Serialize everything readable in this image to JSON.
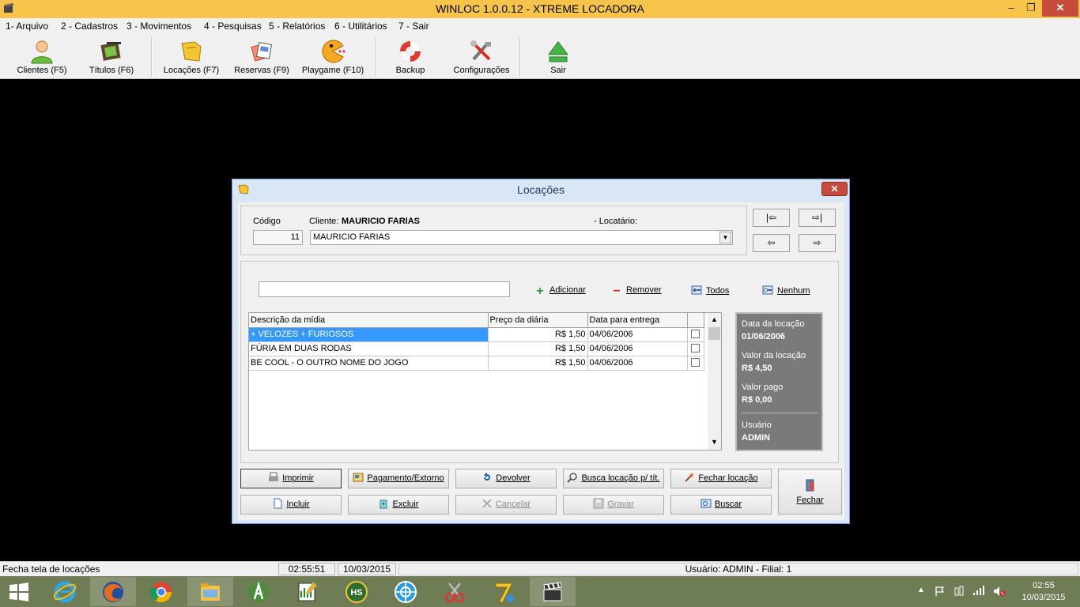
{
  "window": {
    "title": "WINLOC 1.0.0.12 - XTREME LOCADORA",
    "minimize": "–",
    "maximize": "❐",
    "close": "✕"
  },
  "menu": [
    {
      "label": "1- Arquivo"
    },
    {
      "label": "2 - Cadastros"
    },
    {
      "label": "3 - Movimentos"
    },
    {
      "label": "4 - Pesquisas"
    },
    {
      "label": "5 - Relatórios"
    },
    {
      "label": "6 - Utilitários"
    },
    {
      "label": "7 - Sair"
    }
  ],
  "toolbar": [
    {
      "label": "Clientes (F5)",
      "icon": "person-icon"
    },
    {
      "label": "Títulos (F6)",
      "icon": "film-icon"
    },
    {
      "label": "Locações (F7)",
      "icon": "rental-icon"
    },
    {
      "label": "Reservas (F9)",
      "icon": "reservation-icon"
    },
    {
      "label": "Playgame (F10)",
      "icon": "pacman-icon"
    },
    {
      "label": "Backup",
      "icon": "lifebuoy-icon"
    },
    {
      "label": "Configurações",
      "icon": "tools-icon"
    },
    {
      "label": "Sair",
      "icon": "exit-arrow-icon"
    }
  ],
  "dialog": {
    "title": "Locações",
    "close": "✕",
    "codigo_label": "Código",
    "codigo_value": "11",
    "cliente_label": "Cliente:",
    "cliente_name": "MAURICIO FARIAS",
    "locatario_label": "- Locatário:",
    "locatario_value": "MAURICIO FARIAS",
    "nav": {
      "first": "|⇦",
      "last": "⇨|",
      "prev": "⇦",
      "next": "⇨"
    },
    "search_value": "",
    "adicionar": "Adicionar",
    "remover": "Remover",
    "todos": "Todos",
    "nenhum": "Nenhum",
    "columns": [
      "Descrição da mídia",
      "Preço da diária",
      "Data para entrega",
      ""
    ],
    "rows": [
      {
        "desc": "+ VELOZES + FURIOSOS",
        "preco": "R$ 1,50",
        "data": "04/06/2006"
      },
      {
        "desc": "FÚRIA EM DUAS RODAS",
        "preco": "R$ 1,50",
        "data": "04/06/2006"
      },
      {
        "desc": "BE COOL - O OUTRO NOME DO JOGO",
        "preco": "R$ 1,50",
        "data": "04/06/2006"
      }
    ],
    "info": {
      "data_label": "Data da locação",
      "data_value": "01/06/2006",
      "valor_label": "Valor da locação",
      "valor_value": "R$ 4,50",
      "pago_label": "Valor pago",
      "pago_value": "R$ 0,00",
      "usuario_label": "Usuário",
      "usuario_value": "ADMIN"
    },
    "buttons": {
      "imprimir": "Imprimir",
      "pagamento": "Pagamento/Extorno",
      "devolver": "Devolver",
      "busca": "Busca locação p/ tít.",
      "fechar_loc": "Fechar locação",
      "fechar": "Fechar",
      "incluir": "Incluir",
      "excluir": "Excluir",
      "cancelar": "Cancelar",
      "gravar": "Gravar",
      "buscar": "Buscar"
    }
  },
  "status": {
    "message": "Fecha tela de locações",
    "time": "02:55:51",
    "date": "10/03/2015",
    "user": "Usuário: ADMIN - Filial: 1"
  },
  "taskbar": {
    "items": [
      "windows-start-icon",
      "internet-explorer-icon",
      "firefox-icon",
      "chrome-icon",
      "file-explorer-icon",
      "android-studio-icon",
      "notepad-chart-icon",
      "hs-app-icon",
      "network-app-icon",
      "scissors-app-icon",
      "seven-app-icon",
      "clapperboard-icon"
    ],
    "clock_time": "02:55",
    "clock_date": "10/03/2015"
  },
  "colors": {
    "titlebar": "#f6c44a",
    "taskbar": "#6e7d56",
    "selection": "#3399ff",
    "close": "#c74b3a"
  }
}
